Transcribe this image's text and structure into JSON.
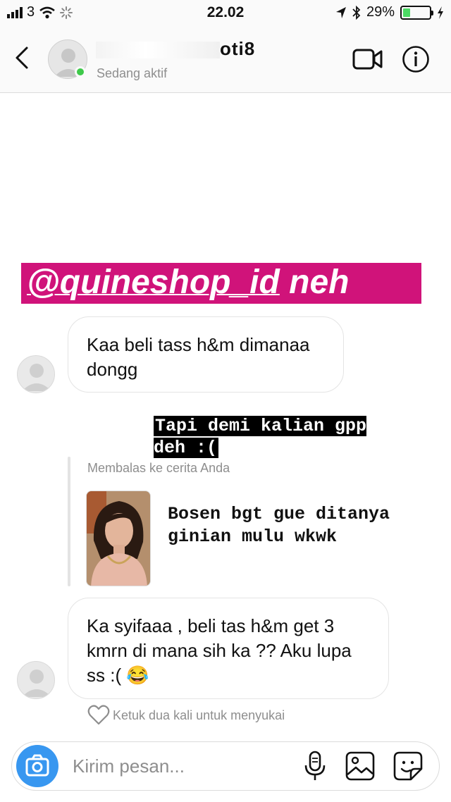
{
  "status_bar": {
    "carrier": "3",
    "time": "22.02",
    "battery_percent": "29%",
    "battery_level": 0.29,
    "icons": [
      "signal-icon",
      "wifi-icon",
      "loading-icon",
      "location-icon",
      "bluetooth-icon",
      "battery-icon",
      "charging-icon"
    ]
  },
  "header": {
    "username_suffix": "oti8",
    "status": "Sedang aktif",
    "icons": [
      "back-chevron-icon",
      "video-call-icon",
      "info-icon"
    ]
  },
  "story_mention": {
    "mention": "@quineshop_id",
    "text": "neh",
    "background": "#d0137a"
  },
  "messages": [
    {
      "text": "Kaa beli tass h&m dimanaa dongg"
    },
    {
      "text": "Ka syifaaa , beli tas h&m get 3 kmrn di mana sih ka ?? Aku lupa ss :(",
      "emoji": "😂"
    }
  ],
  "story_reply": {
    "caption": "Tapi demi kalian gpp deh :(",
    "label": "Membalas ke cerita Anda",
    "story_text": "Bosen bgt gue ditanya ginian mulu wkwk"
  },
  "like_hint": "Ketuk dua kali untuk menyukai",
  "composer": {
    "placeholder": "Kirim pesan...",
    "accent": "#3897f0",
    "icons": [
      "camera-icon",
      "microphone-icon",
      "gallery-icon",
      "sticker-icon"
    ]
  }
}
